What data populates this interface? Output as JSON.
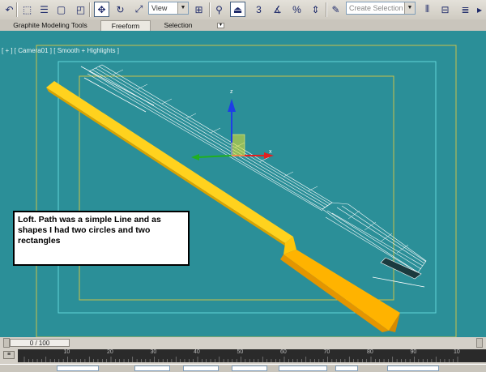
{
  "toolbar": {
    "view_dropdown": "View",
    "selection_set_placeholder": "Create Selection Se"
  },
  "ribbon": {
    "tabs": [
      {
        "label": "Graphite Modeling Tools"
      },
      {
        "label": "Freeform"
      },
      {
        "label": "Selection"
      }
    ]
  },
  "viewport": {
    "label": "[ + ] [ Camera01 ] [ Smooth + Highlights ]",
    "annotation": "Loft. Path was a simple Line and as shapes I had two circles and two rectangles",
    "gizmo": {
      "z_label": "z",
      "x_label": "x"
    }
  },
  "timeline": {
    "frame_readout": "0 / 100",
    "ticks": [
      "10",
      "20",
      "30",
      "40",
      "50",
      "60",
      "70",
      "80",
      "90",
      "10"
    ]
  },
  "colors": {
    "viewport_bg": "#2b8f98",
    "loft_object": "#ffd21e",
    "safe_frame_outer": "#c8c24a",
    "safe_frame_inner": "#61d4d8"
  }
}
